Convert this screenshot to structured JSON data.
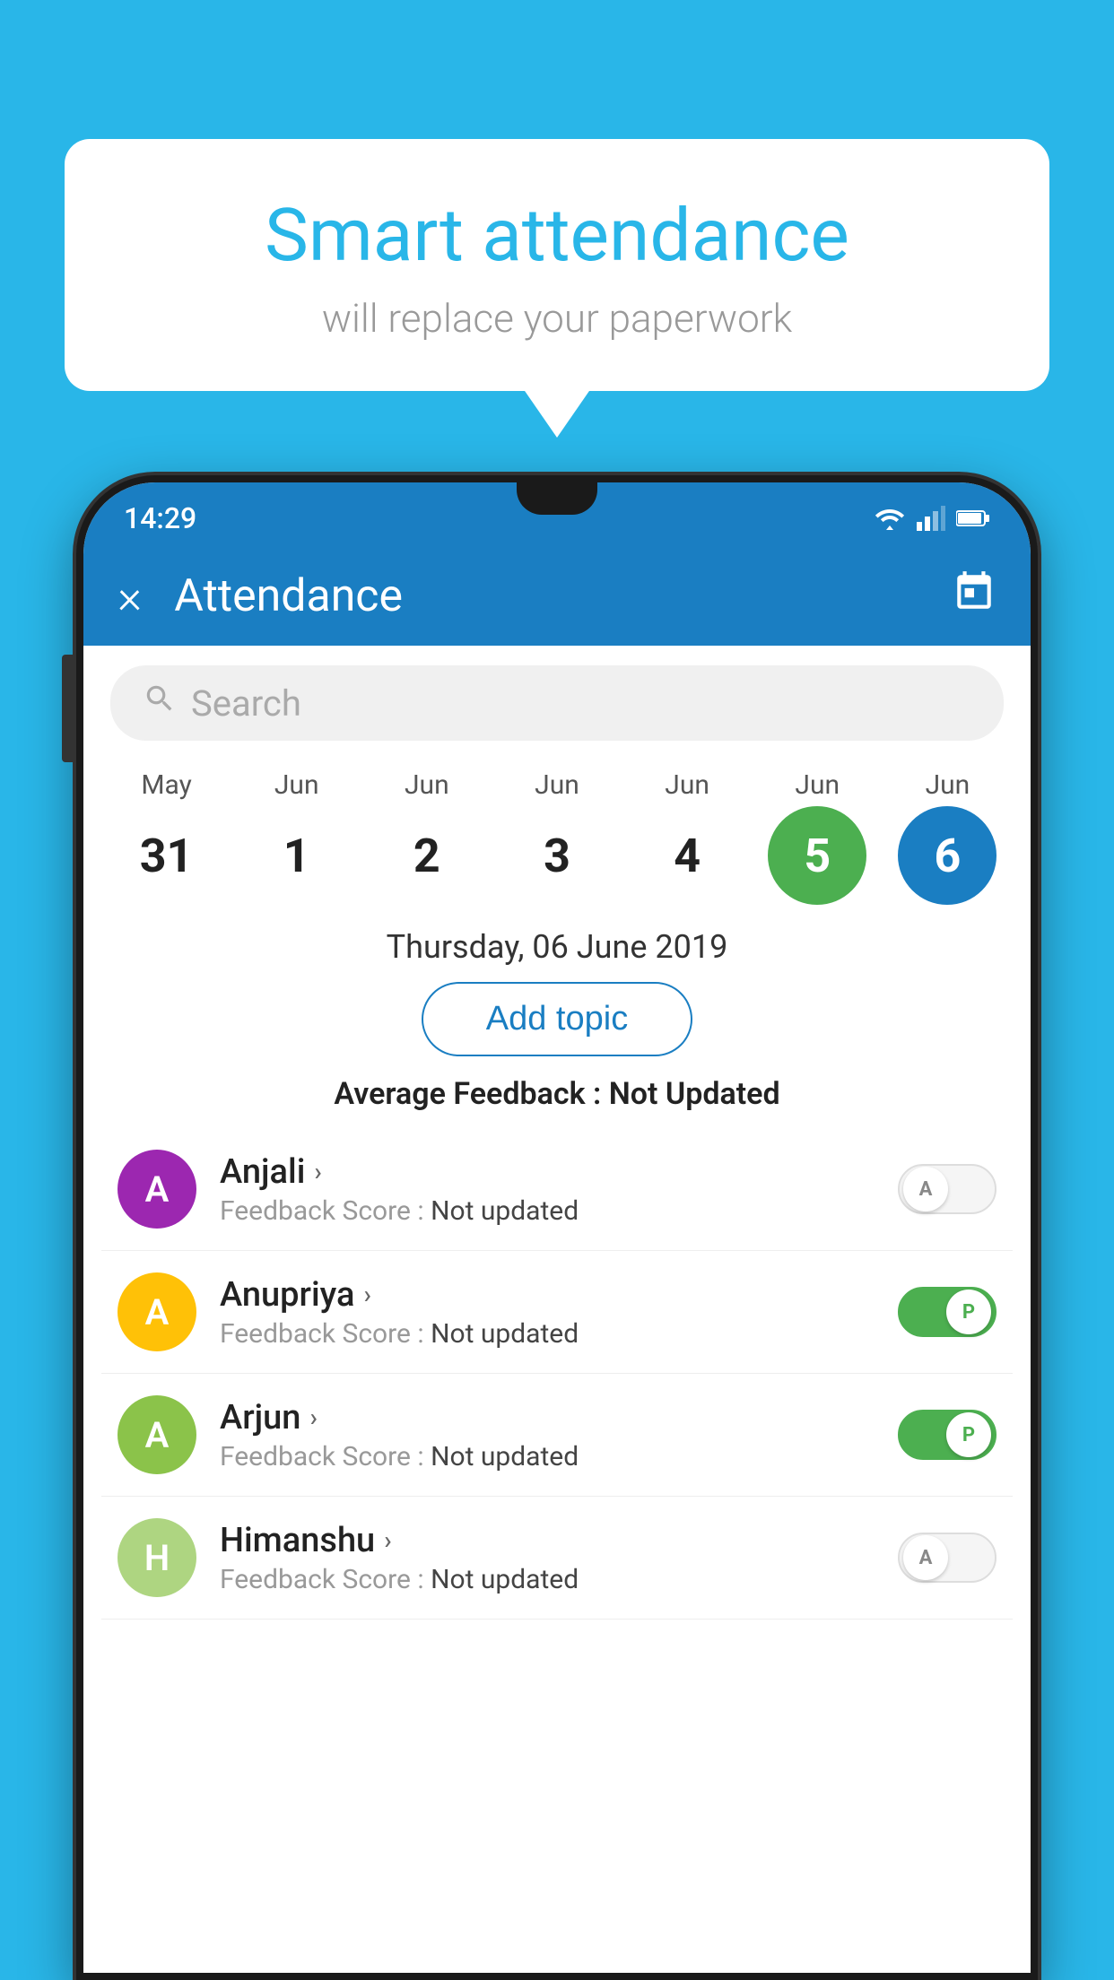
{
  "background_color": "#29b6e8",
  "bubble": {
    "title": "Smart attendance",
    "subtitle": "will replace your paperwork"
  },
  "status_bar": {
    "time": "14:29"
  },
  "app_bar": {
    "title": "Attendance",
    "close_label": "×",
    "calendar_icon": "📅"
  },
  "search": {
    "placeholder": "Search"
  },
  "calendar": {
    "columns": [
      {
        "month": "May",
        "day": "31",
        "style": "normal"
      },
      {
        "month": "Jun",
        "day": "1",
        "style": "normal"
      },
      {
        "month": "Jun",
        "day": "2",
        "style": "normal"
      },
      {
        "month": "Jun",
        "day": "3",
        "style": "normal"
      },
      {
        "month": "Jun",
        "day": "4",
        "style": "normal"
      },
      {
        "month": "Jun",
        "day": "5",
        "style": "active-green"
      },
      {
        "month": "Jun",
        "day": "6",
        "style": "active-blue"
      }
    ]
  },
  "date_label": "Thursday, 06 June 2019",
  "add_topic_label": "Add topic",
  "avg_feedback_label": "Average Feedback : ",
  "avg_feedback_value": "Not Updated",
  "students": [
    {
      "name": "Anjali",
      "avatar_letter": "A",
      "avatar_color": "#9c27b0",
      "feedback_label": "Feedback Score : ",
      "feedback_value": "Not updated",
      "toggle_state": "off",
      "toggle_label": "A"
    },
    {
      "name": "Anupriya",
      "avatar_letter": "A",
      "avatar_color": "#ffc107",
      "feedback_label": "Feedback Score : ",
      "feedback_value": "Not updated",
      "toggle_state": "on",
      "toggle_label": "P"
    },
    {
      "name": "Arjun",
      "avatar_letter": "A",
      "avatar_color": "#8bc34a",
      "feedback_label": "Feedback Score : ",
      "feedback_value": "Not updated",
      "toggle_state": "on",
      "toggle_label": "P"
    },
    {
      "name": "Himanshu",
      "avatar_letter": "H",
      "avatar_color": "#aed581",
      "feedback_label": "Feedback Score : ",
      "feedback_value": "Not updated",
      "toggle_state": "off",
      "toggle_label": "A"
    }
  ]
}
